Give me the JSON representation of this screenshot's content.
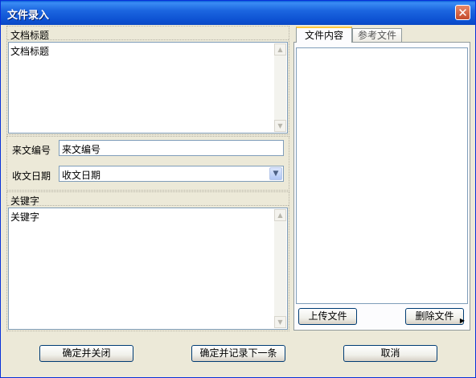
{
  "window": {
    "title": "文件录入",
    "close_glyph": "✕"
  },
  "doc_title": {
    "group_label": "文档标题",
    "value": "文档标题"
  },
  "meta": {
    "doc_no_label": "来文编号",
    "doc_no_value": "来文编号",
    "date_label": "收文日期",
    "date_value": "收文日期"
  },
  "keywords": {
    "group_label": "关键字",
    "value": "关键字"
  },
  "tabs": [
    {
      "label": "文件内容",
      "active": true
    },
    {
      "label": "参考文件",
      "active": false
    }
  ],
  "file_panel": {
    "upload_label": "上传文件",
    "delete_label": "删除文件"
  },
  "footer": {
    "confirm_close": "确定并关闭",
    "confirm_next": "确定并记录下一条",
    "cancel": "取消"
  },
  "icons": {
    "scroll_up": "▲",
    "scroll_down": "▼",
    "dropdown": "▼",
    "corner_arrow": "▶"
  }
}
